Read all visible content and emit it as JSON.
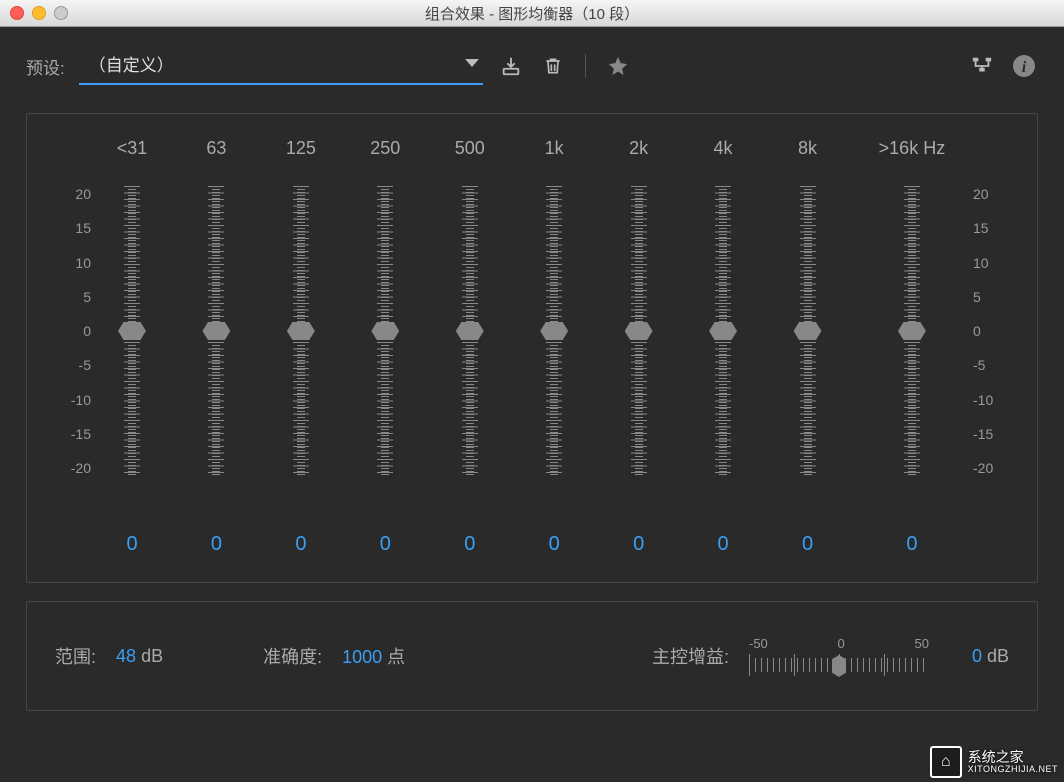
{
  "window": {
    "title": "组合效果 - 图形均衡器（10 段）"
  },
  "toolbar": {
    "preset_label": "预设:",
    "preset_value": "（自定义）"
  },
  "eq": {
    "scale": [
      "20",
      "15",
      "10",
      "5",
      "0",
      "-5",
      "-10",
      "-15",
      "-20"
    ],
    "bands": [
      {
        "label": "<31",
        "value": "0"
      },
      {
        "label": "63",
        "value": "0"
      },
      {
        "label": "125",
        "value": "0"
      },
      {
        "label": "250",
        "value": "0"
      },
      {
        "label": "500",
        "value": "0"
      },
      {
        "label": "1k",
        "value": "0"
      },
      {
        "label": "2k",
        "value": "0"
      },
      {
        "label": "4k",
        "value": "0"
      },
      {
        "label": "8k",
        "value": "0"
      },
      {
        "label": ">16k Hz",
        "value": "0"
      }
    ]
  },
  "bottom": {
    "range_label": "范围:",
    "range_value": "48",
    "range_unit": "dB",
    "accuracy_label": "准确度:",
    "accuracy_value": "1000",
    "accuracy_unit": "点",
    "master_label": "主控增益:",
    "master_ticks": [
      "-50",
      "0",
      "50"
    ],
    "master_value": "0",
    "master_unit": "dB"
  },
  "watermark": {
    "brand": "系统之家",
    "url": "XITONGZHIJIA.NET"
  }
}
